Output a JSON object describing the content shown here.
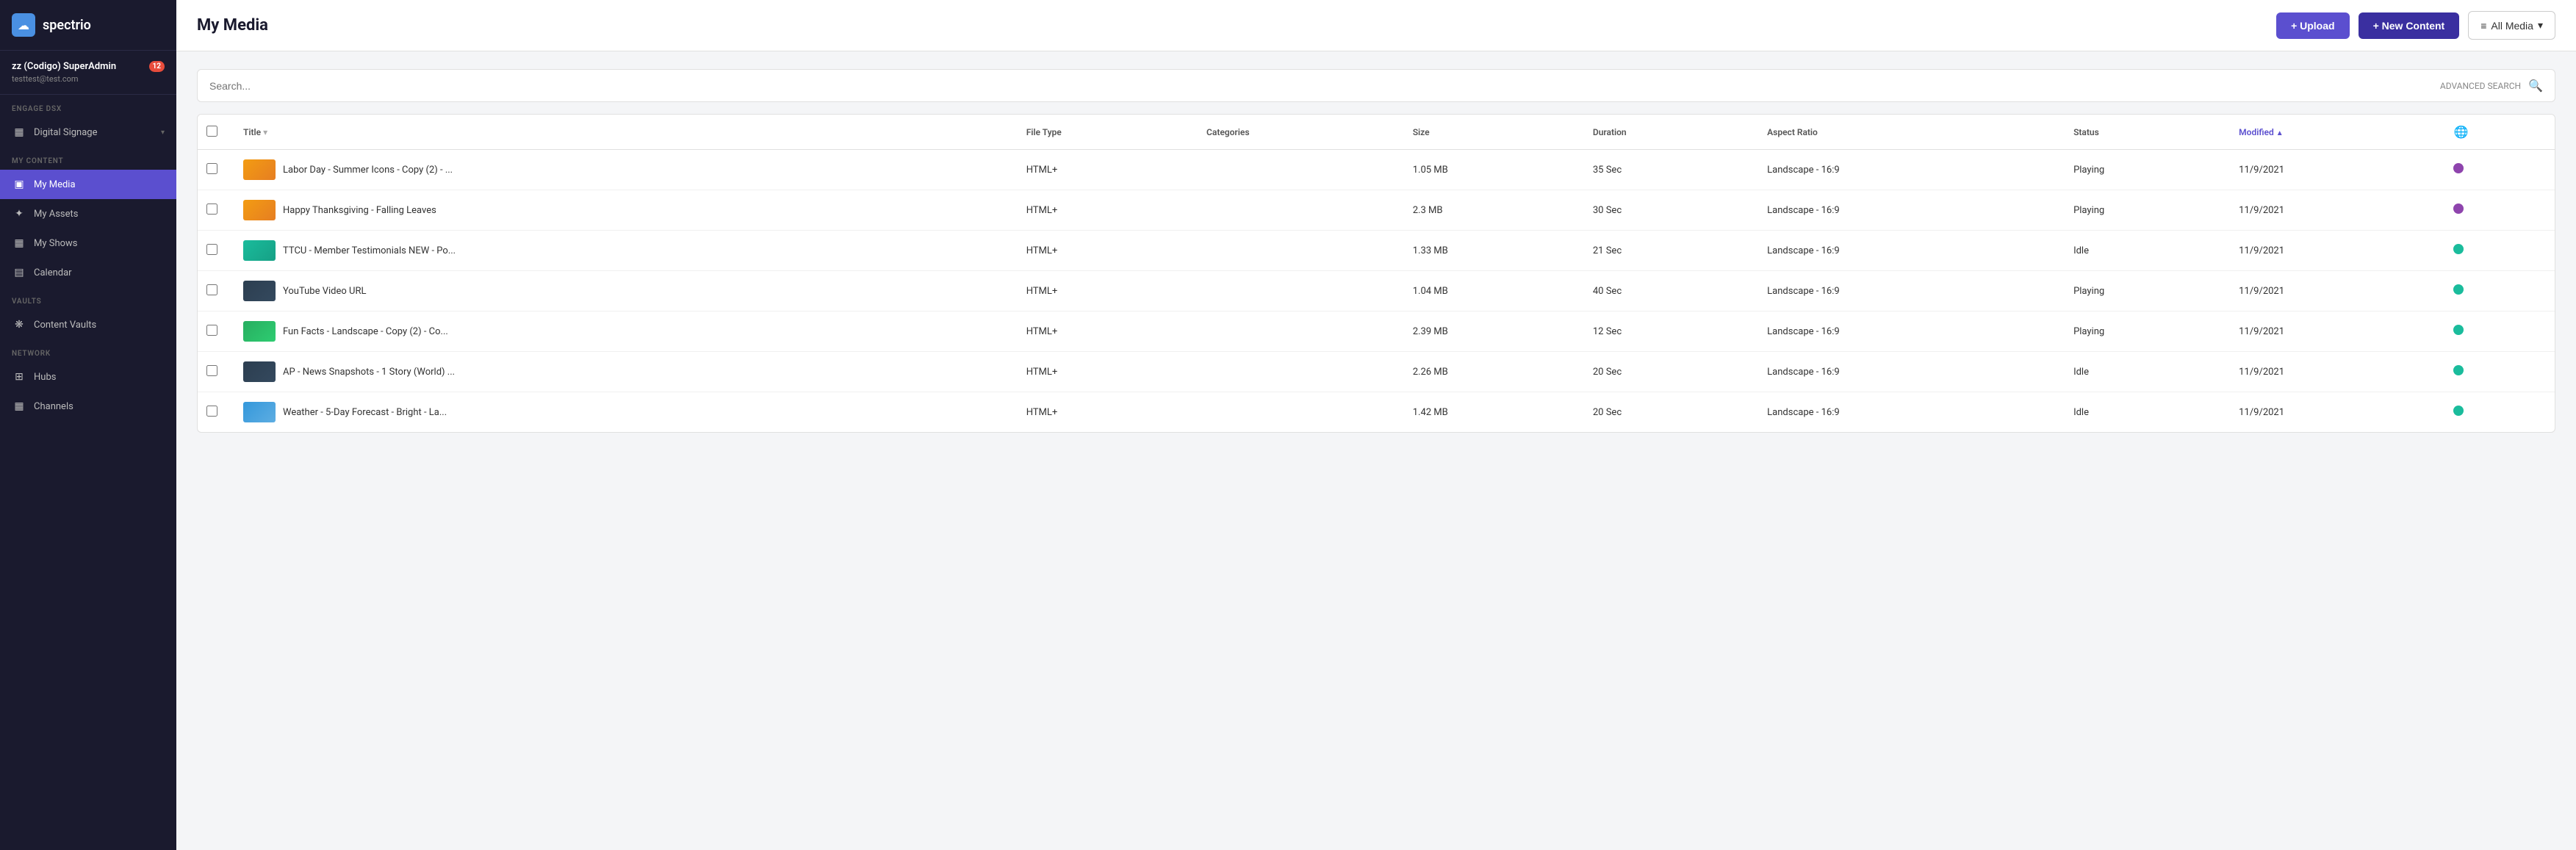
{
  "app": {
    "name": "spectrio",
    "logo_char": "☁"
  },
  "user": {
    "name": "zz (Codigo) SuperAdmin",
    "email": "testtest@test.com",
    "notification_count": "12"
  },
  "sidebar": {
    "engage_label": "Engage DSX",
    "my_content_label": "My Content",
    "vaults_label": "Vaults",
    "network_label": "Network",
    "items": [
      {
        "id": "digital-signage",
        "label": "Digital Signage",
        "icon": "▦",
        "has_chevron": true
      },
      {
        "id": "my-media",
        "label": "My Media",
        "icon": "▣",
        "active": true
      },
      {
        "id": "my-assets",
        "label": "My Assets",
        "icon": "✦"
      },
      {
        "id": "my-shows",
        "label": "My Shows",
        "icon": "▦"
      },
      {
        "id": "calendar",
        "label": "Calendar",
        "icon": "▤"
      },
      {
        "id": "content-vaults",
        "label": "Content Vaults",
        "icon": "❋"
      },
      {
        "id": "hubs",
        "label": "Hubs",
        "icon": "⊞"
      },
      {
        "id": "channels",
        "label": "Channels",
        "icon": "▦"
      }
    ]
  },
  "topbar": {
    "title": "My Media",
    "upload_label": "+ Upload",
    "new_content_label": "+ New Content",
    "all_media_label": "All Media"
  },
  "search": {
    "placeholder": "Search...",
    "advanced_label": "ADVANCED SEARCH"
  },
  "table": {
    "columns": [
      "",
      "Title",
      "File Type",
      "Categories",
      "Size",
      "Duration",
      "Aspect Ratio",
      "Status",
      "Modified",
      ""
    ],
    "rows": [
      {
        "id": 1,
        "thumb_class": "thumb-orange",
        "title": "Labor Day - Summer Icons - Copy (2) - ...",
        "file_type": "HTML+",
        "categories": "",
        "size": "1.05 MB",
        "duration": "35 Sec",
        "aspect_ratio": "Landscape - 16:9",
        "status": "Playing",
        "modified": "11/9/2021",
        "icon_class": "icon-purple"
      },
      {
        "id": 2,
        "thumb_class": "thumb-orange",
        "title": "Happy Thanksgiving - Falling Leaves",
        "file_type": "HTML+",
        "categories": "",
        "size": "2.3 MB",
        "duration": "30 Sec",
        "aspect_ratio": "Landscape - 16:9",
        "status": "Playing",
        "modified": "11/9/2021",
        "icon_class": "icon-purple"
      },
      {
        "id": 3,
        "thumb_class": "thumb-teal",
        "title": "TTCU - Member Testimonials NEW - Po...",
        "file_type": "HTML+",
        "categories": "",
        "size": "1.33 MB",
        "duration": "21 Sec",
        "aspect_ratio": "Landscape - 16:9",
        "status": "Idle",
        "modified": "11/9/2021",
        "icon_class": "icon-teal"
      },
      {
        "id": 4,
        "thumb_class": "thumb-dark",
        "title": "YouTube Video URL",
        "file_type": "HTML+",
        "categories": "",
        "size": "1.04 MB",
        "duration": "40 Sec",
        "aspect_ratio": "Landscape - 16:9",
        "status": "Playing",
        "modified": "11/9/2021",
        "icon_class": "icon-teal"
      },
      {
        "id": 5,
        "thumb_class": "thumb-green",
        "title": "Fun Facts - Landscape - Copy (2) - Co...",
        "file_type": "HTML+",
        "categories": "",
        "size": "2.39 MB",
        "duration": "12 Sec",
        "aspect_ratio": "Landscape - 16:9",
        "status": "Playing",
        "modified": "11/9/2021",
        "icon_class": "icon-teal"
      },
      {
        "id": 6,
        "thumb_class": "thumb-dark",
        "title": "AP - News Snapshots - 1 Story (World) ...",
        "file_type": "HTML+",
        "categories": "",
        "size": "2.26 MB",
        "duration": "20 Sec",
        "aspect_ratio": "Landscape - 16:9",
        "status": "Idle",
        "modified": "11/9/2021",
        "icon_class": "icon-teal"
      },
      {
        "id": 7,
        "thumb_class": "thumb-sky",
        "title": "Weather - 5-Day Forecast - Bright - La...",
        "file_type": "HTML+",
        "categories": "",
        "size": "1.42 MB",
        "duration": "20 Sec",
        "aspect_ratio": "Landscape - 16:9",
        "status": "Idle",
        "modified": "11/9/2021",
        "icon_class": "icon-teal"
      }
    ]
  }
}
